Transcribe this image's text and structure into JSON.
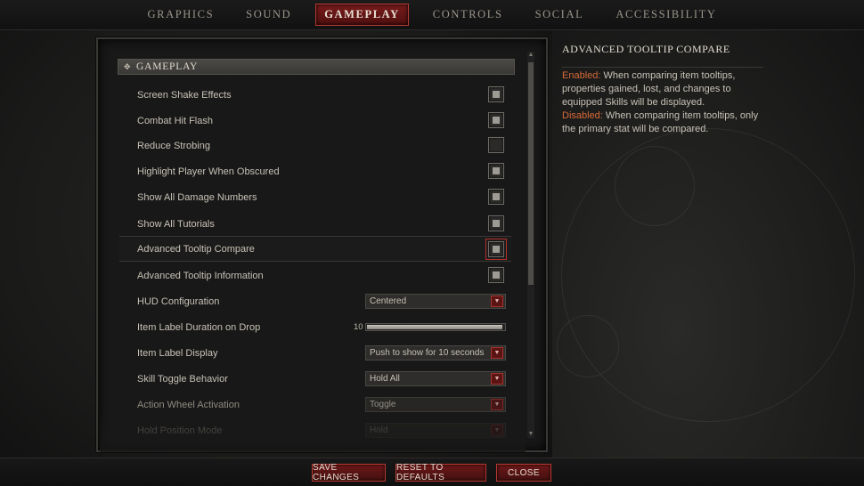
{
  "tabs": [
    {
      "label": "GRAPHICS",
      "active": false
    },
    {
      "label": "SOUND",
      "active": false
    },
    {
      "label": "GAMEPLAY",
      "active": true
    },
    {
      "label": "CONTROLS",
      "active": false
    },
    {
      "label": "SOCIAL",
      "active": false
    },
    {
      "label": "ACCESSIBILITY",
      "active": false
    }
  ],
  "section": {
    "title": "GAMEPLAY",
    "icon": "expand-icon"
  },
  "settings": [
    {
      "label": "Screen Shake Effects",
      "type": "checkbox",
      "checked": true
    },
    {
      "label": "Combat Hit Flash",
      "type": "checkbox",
      "checked": true
    },
    {
      "label": "Reduce Strobing",
      "type": "checkbox",
      "checked": false
    },
    {
      "label": "Highlight Player When Obscured",
      "type": "checkbox",
      "checked": true
    },
    {
      "label": "Show All Damage Numbers",
      "type": "checkbox",
      "checked": true
    },
    {
      "label": "Show All Tutorials",
      "type": "checkbox",
      "checked": true
    },
    {
      "label": "Advanced Tooltip Compare",
      "type": "checkbox",
      "checked": true,
      "focused": true
    },
    {
      "label": "Advanced Tooltip Information",
      "type": "checkbox",
      "checked": true
    },
    {
      "label": "HUD Configuration",
      "type": "dropdown",
      "value": "Centered"
    },
    {
      "label": "Item Label Duration on Drop",
      "type": "slider",
      "value": "10",
      "fill": 0.99
    },
    {
      "label": "Item Label Display",
      "type": "dropdown",
      "value": "Push to show for 10 seconds"
    },
    {
      "label": "Skill Toggle Behavior",
      "type": "dropdown",
      "value": "Hold All"
    },
    {
      "label": "Action Wheel Activation",
      "type": "dropdown",
      "value": "Toggle",
      "dim": true
    },
    {
      "label": "Hold Position Mode",
      "type": "dropdown",
      "value": "Hold",
      "faded": true
    }
  ],
  "description": {
    "title": "ADVANCED TOOLTIP COMPARE",
    "enabled_key": "Enabled:",
    "enabled_text": " When comparing item tooltips, properties gained, lost, and changes to equipped Skills will be displayed.",
    "disabled_key": "Disabled:",
    "disabled_text": " When comparing item tooltips, only the primary stat will be compared."
  },
  "buttons": {
    "save": "SAVE CHANGES",
    "reset": "RESET TO DEFAULTS",
    "close": "CLOSE"
  },
  "scroll": {
    "up_icon": "▲",
    "down_icon": "▼"
  },
  "colors": {
    "accent": "#b43a33",
    "highlight_text": "#d86a38"
  }
}
